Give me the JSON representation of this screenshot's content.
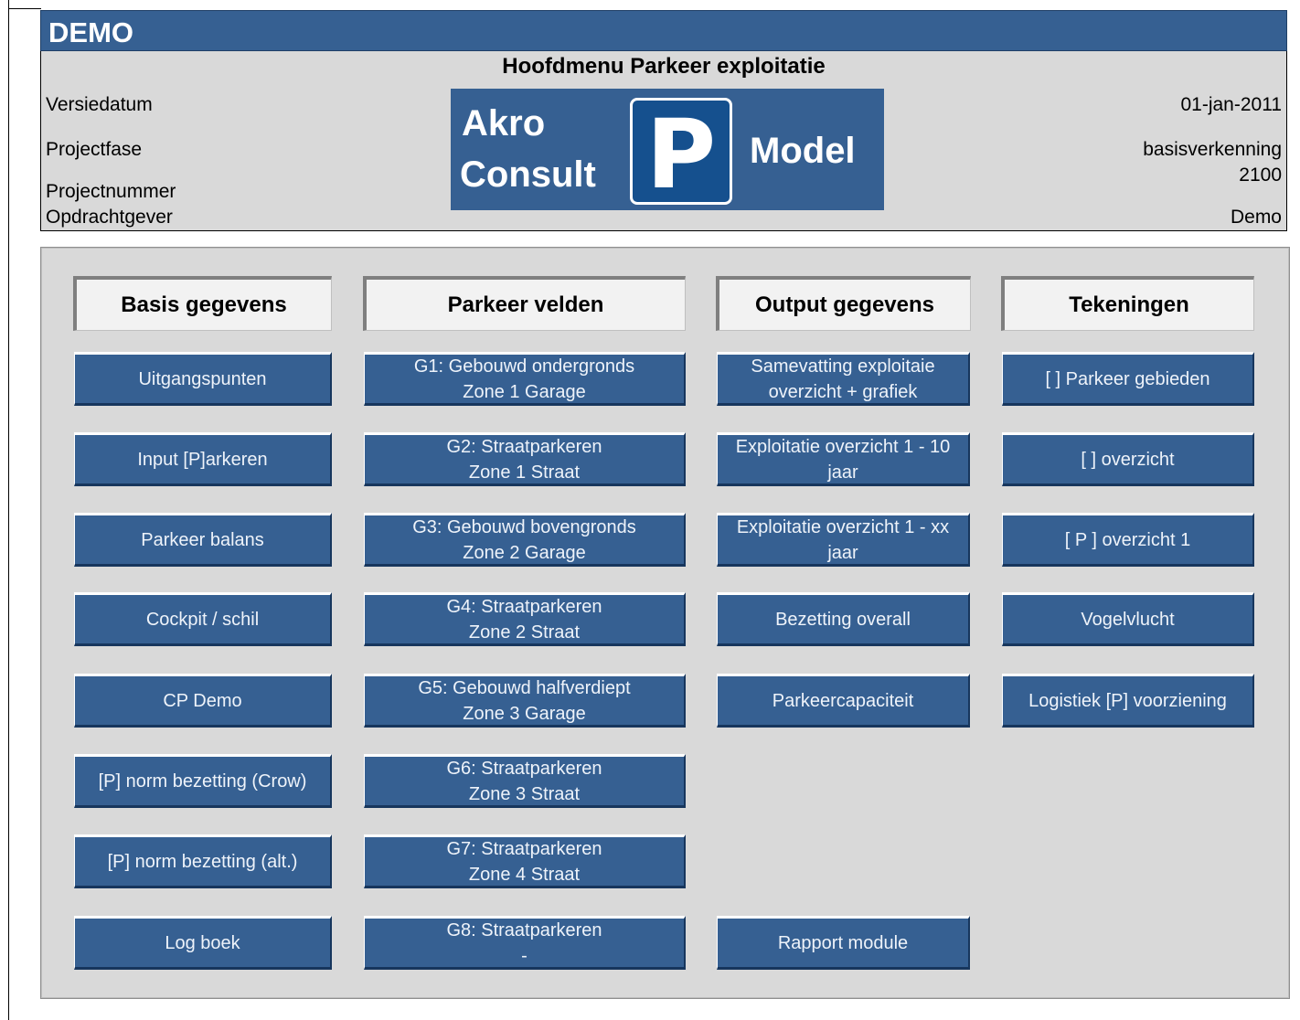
{
  "demo_label": "DEMO",
  "header": {
    "title": "Hoofdmenu Parkeer exploitatie",
    "labels": {
      "versiedatum": "Versiedatum",
      "projectfase": "Projectfase",
      "projectnummer": "Projectnummer",
      "opdrachtgever": "Opdrachtgever"
    },
    "values": {
      "versiedatum": "01-jan-2011",
      "projectfase": "basisverkenning",
      "projectnummer": "2100",
      "opdrachtgever": "Demo"
    }
  },
  "logo": {
    "line1": "Akro",
    "line2": "Consult",
    "sign": "P",
    "word": "Model"
  },
  "columns": {
    "basis": {
      "header": "Basis gegevens",
      "buttons": [
        "Uitgangspunten",
        "Input [P]arkeren",
        "Parkeer balans",
        "Cockpit / schil",
        "CP Demo",
        "[P] norm bezetting (Crow)",
        "[P] norm bezetting (alt.)",
        "Log boek"
      ]
    },
    "velden": {
      "header": "Parkeer velden",
      "buttons": [
        {
          "line1": "G1: Gebouwd ondergronds",
          "line2": "Zone 1 Garage"
        },
        {
          "line1": "G2: Straatparkeren",
          "line2": "Zone 1 Straat"
        },
        {
          "line1": "G3: Gebouwd bovengronds",
          "line2": "Zone 2 Garage"
        },
        {
          "line1": "G4: Straatparkeren",
          "line2": "Zone 2 Straat"
        },
        {
          "line1": "G5: Gebouwd halfverdiept",
          "line2": "Zone 3 Garage"
        },
        {
          "line1": "G6: Straatparkeren",
          "line2": "Zone 3 Straat"
        },
        {
          "line1": "G7: Straatparkeren",
          "line2": "Zone 4 Straat"
        },
        {
          "line1": "G8: Straatparkeren",
          "line2": "-"
        }
      ]
    },
    "output": {
      "header": "Output gegevens",
      "buttons": [
        {
          "line1": "Samevatting exploitaie",
          "line2": "overzicht + grafiek"
        },
        {
          "line1": "Exploitatie overzicht 1 - 10",
          "line2": "jaar"
        },
        {
          "line1": "Exploitatie overzicht 1 - xx",
          "line2": "jaar"
        },
        {
          "line1": "Bezetting overall",
          "line2": ""
        },
        {
          "line1": "Parkeercapaciteit",
          "line2": ""
        },
        {
          "line1": "Rapport module",
          "line2": ""
        }
      ]
    },
    "tekeningen": {
      "header": "Tekeningen",
      "buttons": [
        "[ ] Parkeer gebieden",
        "[ ] overzicht",
        "[ P ] overzicht 1",
        "Vogelvlucht",
        "Logistiek [P] voorziening"
      ]
    }
  },
  "colors": {
    "title_bar": "#366092",
    "button": "#366092",
    "panel": "#d9d9d9",
    "header_box": "#f2f2f2"
  }
}
